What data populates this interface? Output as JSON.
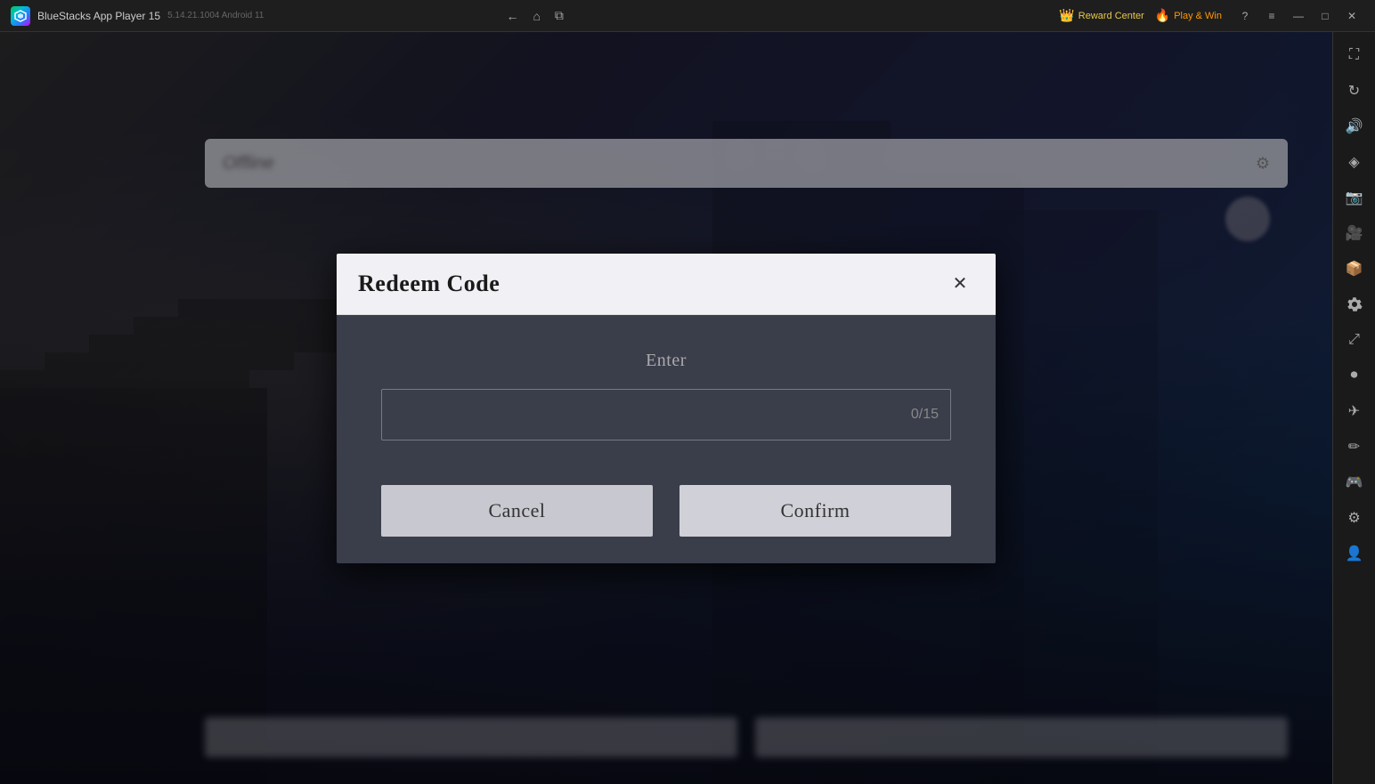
{
  "app": {
    "name": "BlueStacks App Player 15",
    "version": "5.14.21.1004  Android 11"
  },
  "titleBar": {
    "backLabel": "←",
    "homeLabel": "⌂",
    "screenshotLabel": "⧉",
    "rewardCenter": "Reward Center",
    "playAndWin": "Play & Win",
    "helpLabel": "?",
    "menuLabel": "≡",
    "minimizeLabel": "—",
    "maximizeLabel": "□",
    "closeLabel": "✕",
    "fullscreenLabel": "⛶"
  },
  "sidebar": {
    "icons": [
      {
        "name": "fullscreen-icon",
        "symbol": "⛶"
      },
      {
        "name": "rotate-icon",
        "symbol": "↻"
      },
      {
        "name": "volume-icon",
        "symbol": "🔊"
      },
      {
        "name": "shake-icon",
        "symbol": "◈"
      },
      {
        "name": "screenshot-sidebar-icon",
        "symbol": "📷"
      },
      {
        "name": "camera-icon",
        "symbol": "🎥"
      },
      {
        "name": "apk-icon",
        "symbol": "📦"
      },
      {
        "name": "settings-small-icon",
        "symbol": "⚙"
      },
      {
        "name": "resize-icon",
        "symbol": "⤢"
      },
      {
        "name": "macro-icon",
        "symbol": "⏺"
      },
      {
        "name": "flight-icon",
        "symbol": "✈"
      },
      {
        "name": "brush-icon",
        "symbol": "✏"
      },
      {
        "name": "controls-icon",
        "symbol": "🎮"
      },
      {
        "name": "settings-icon",
        "symbol": "⚙"
      },
      {
        "name": "profile-icon",
        "symbol": "👤"
      }
    ]
  },
  "dialog": {
    "title": "Redeem Code",
    "closeLabel": "✕",
    "enterLabel": "Enter",
    "inputPlaceholder": "",
    "inputCounter": "0/15",
    "cancelLabel": "Cancel",
    "confirmLabel": "Confirm"
  }
}
